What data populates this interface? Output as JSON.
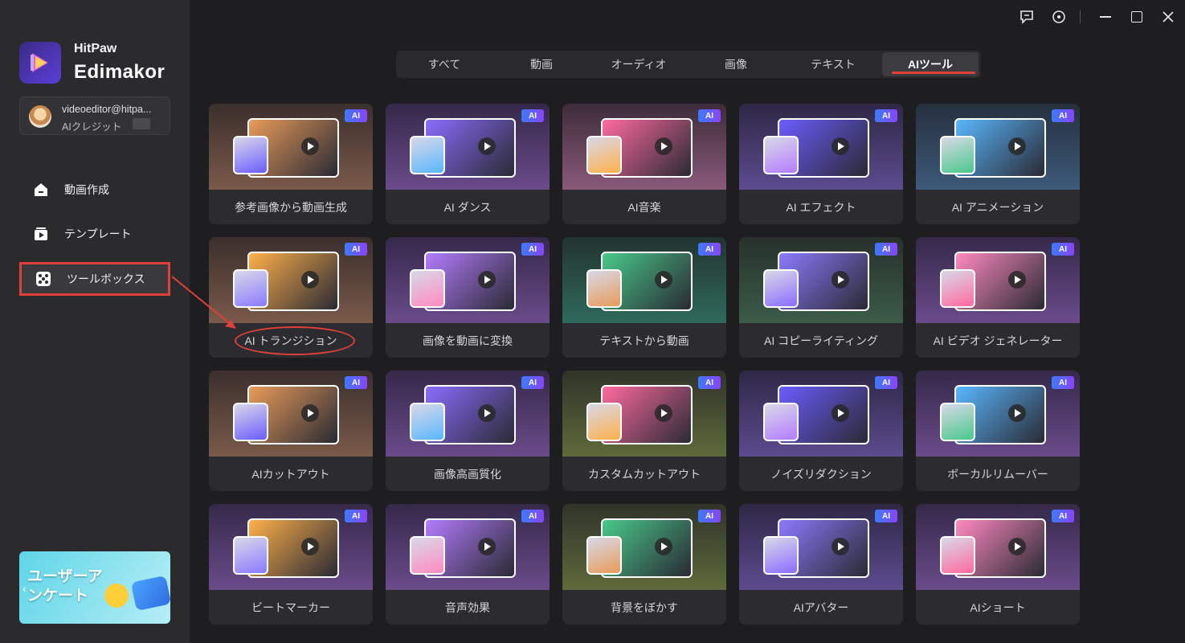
{
  "app": {
    "brand_small": "HitPaw",
    "brand_big": "Edimakor"
  },
  "account": {
    "email": "videoeditor@hitpa...",
    "credit_label": "AIクレジット"
  },
  "sidebar": {
    "items": [
      {
        "label": "動画作成",
        "icon": "home-icon"
      },
      {
        "label": "テンプレート",
        "icon": "template-icon"
      },
      {
        "label": "ツールボックス",
        "icon": "toolbox-icon",
        "active": true
      }
    ],
    "banner_text": "ユーザーアンケート"
  },
  "tabs": [
    {
      "label": "すべて"
    },
    {
      "label": "動画"
    },
    {
      "label": "オーディオ"
    },
    {
      "label": "画像"
    },
    {
      "label": "テキスト"
    },
    {
      "label": "AIツール",
      "active": true
    }
  ],
  "badge_text": "AI",
  "tools": [
    {
      "label": "参考画像から動画生成",
      "theme": "orange"
    },
    {
      "label": "AI ダンス",
      "theme": "purple"
    },
    {
      "label": "AI音楽",
      "theme": "pink"
    },
    {
      "label": "AI エフェクト",
      "theme": "violet"
    },
    {
      "label": "AI アニメーション",
      "theme": "blue"
    },
    {
      "label": "AI トランジション",
      "theme": "orange"
    },
    {
      "label": "画像を動画に変換",
      "theme": "purple"
    },
    {
      "label": "テキストから動画",
      "theme": "teal"
    },
    {
      "label": "AI コピーライティング",
      "theme": "green"
    },
    {
      "label": "AI ビデオ ジェネレーター",
      "theme": "purple"
    },
    {
      "label": "AIカットアウト",
      "theme": "orange"
    },
    {
      "label": "画像高画質化",
      "theme": "purple"
    },
    {
      "label": "カスタムカットアウト",
      "theme": "olive"
    },
    {
      "label": "ノイズリダクション",
      "theme": "violet"
    },
    {
      "label": "ボーカルリムーバー",
      "theme": "purple"
    },
    {
      "label": "ビートマーカー",
      "theme": "purple"
    },
    {
      "label": "音声効果",
      "theme": "purple"
    },
    {
      "label": "背景をぼかす",
      "theme": "olive"
    },
    {
      "label": "AIアバター",
      "theme": "violet"
    },
    {
      "label": "AIショート",
      "theme": "purple"
    }
  ],
  "colors": {
    "accent_red": "#e0403a",
    "badge_gradient_start": "#3b7bff",
    "badge_gradient_end": "#8a44ff"
  }
}
